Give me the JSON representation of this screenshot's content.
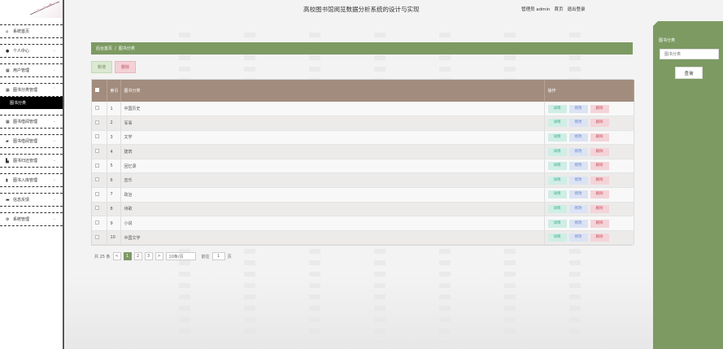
{
  "app_title": "高校图书馆阅览数据分析系统的设计与实现",
  "user": {
    "role_user": "管理员 admin",
    "home": "首页",
    "logout": "退出登录"
  },
  "sidebar": {
    "items": [
      {
        "label": "系统首页",
        "icon": "home-icon"
      },
      {
        "label": "个人中心",
        "icon": "user-icon"
      },
      {
        "label": "用户管理",
        "icon": "grid-icon"
      },
      {
        "label": "图书分类管理",
        "icon": "grid-icon"
      },
      {
        "label": "图书分类",
        "sub": true
      },
      {
        "label": "图书借阅管理",
        "icon": "grid-icon"
      },
      {
        "label": "图书借阅管理",
        "icon": "book-icon"
      },
      {
        "label": "图书归还管理",
        "icon": "return-icon"
      },
      {
        "label": "图书入库管理",
        "icon": "chart-icon"
      },
      {
        "label": "信息反馈",
        "icon": "message-icon"
      },
      {
        "label": "系统管理",
        "icon": "settings-icon"
      }
    ]
  },
  "breadcrumb": {
    "home": "后台首页",
    "sep": "/",
    "current": "图书分类"
  },
  "actions": {
    "new": "新增",
    "delete": "删除"
  },
  "table": {
    "headers": {
      "index": "索引",
      "category": "图书分类",
      "ops": "操作"
    },
    "ops": {
      "view": "详情",
      "edit": "修改",
      "delete": "删除"
    },
    "rows": [
      {
        "index": "1",
        "category": "中国历史"
      },
      {
        "index": "2",
        "category": "军事"
      },
      {
        "index": "3",
        "category": "文学"
      },
      {
        "index": "4",
        "category": "建筑"
      },
      {
        "index": "5",
        "category": "回忆录"
      },
      {
        "index": "6",
        "category": "音乐"
      },
      {
        "index": "7",
        "category": "政治"
      },
      {
        "index": "8",
        "category": "诗歌"
      },
      {
        "index": "9",
        "category": "小说"
      },
      {
        "index": "10",
        "category": "中国文学"
      }
    ]
  },
  "pager": {
    "total": "共 25 条",
    "prev": "<",
    "pages": [
      "1",
      "2",
      "3"
    ],
    "next": ">",
    "page_size": "10条/页",
    "goto": "前往",
    "goto_value": "1",
    "unit": "页"
  },
  "search": {
    "label": "图书分类",
    "placeholder": "图书分类",
    "button": "查询"
  },
  "colors": {
    "accent": "#7d9a63",
    "table_header": "#a28c7d"
  }
}
